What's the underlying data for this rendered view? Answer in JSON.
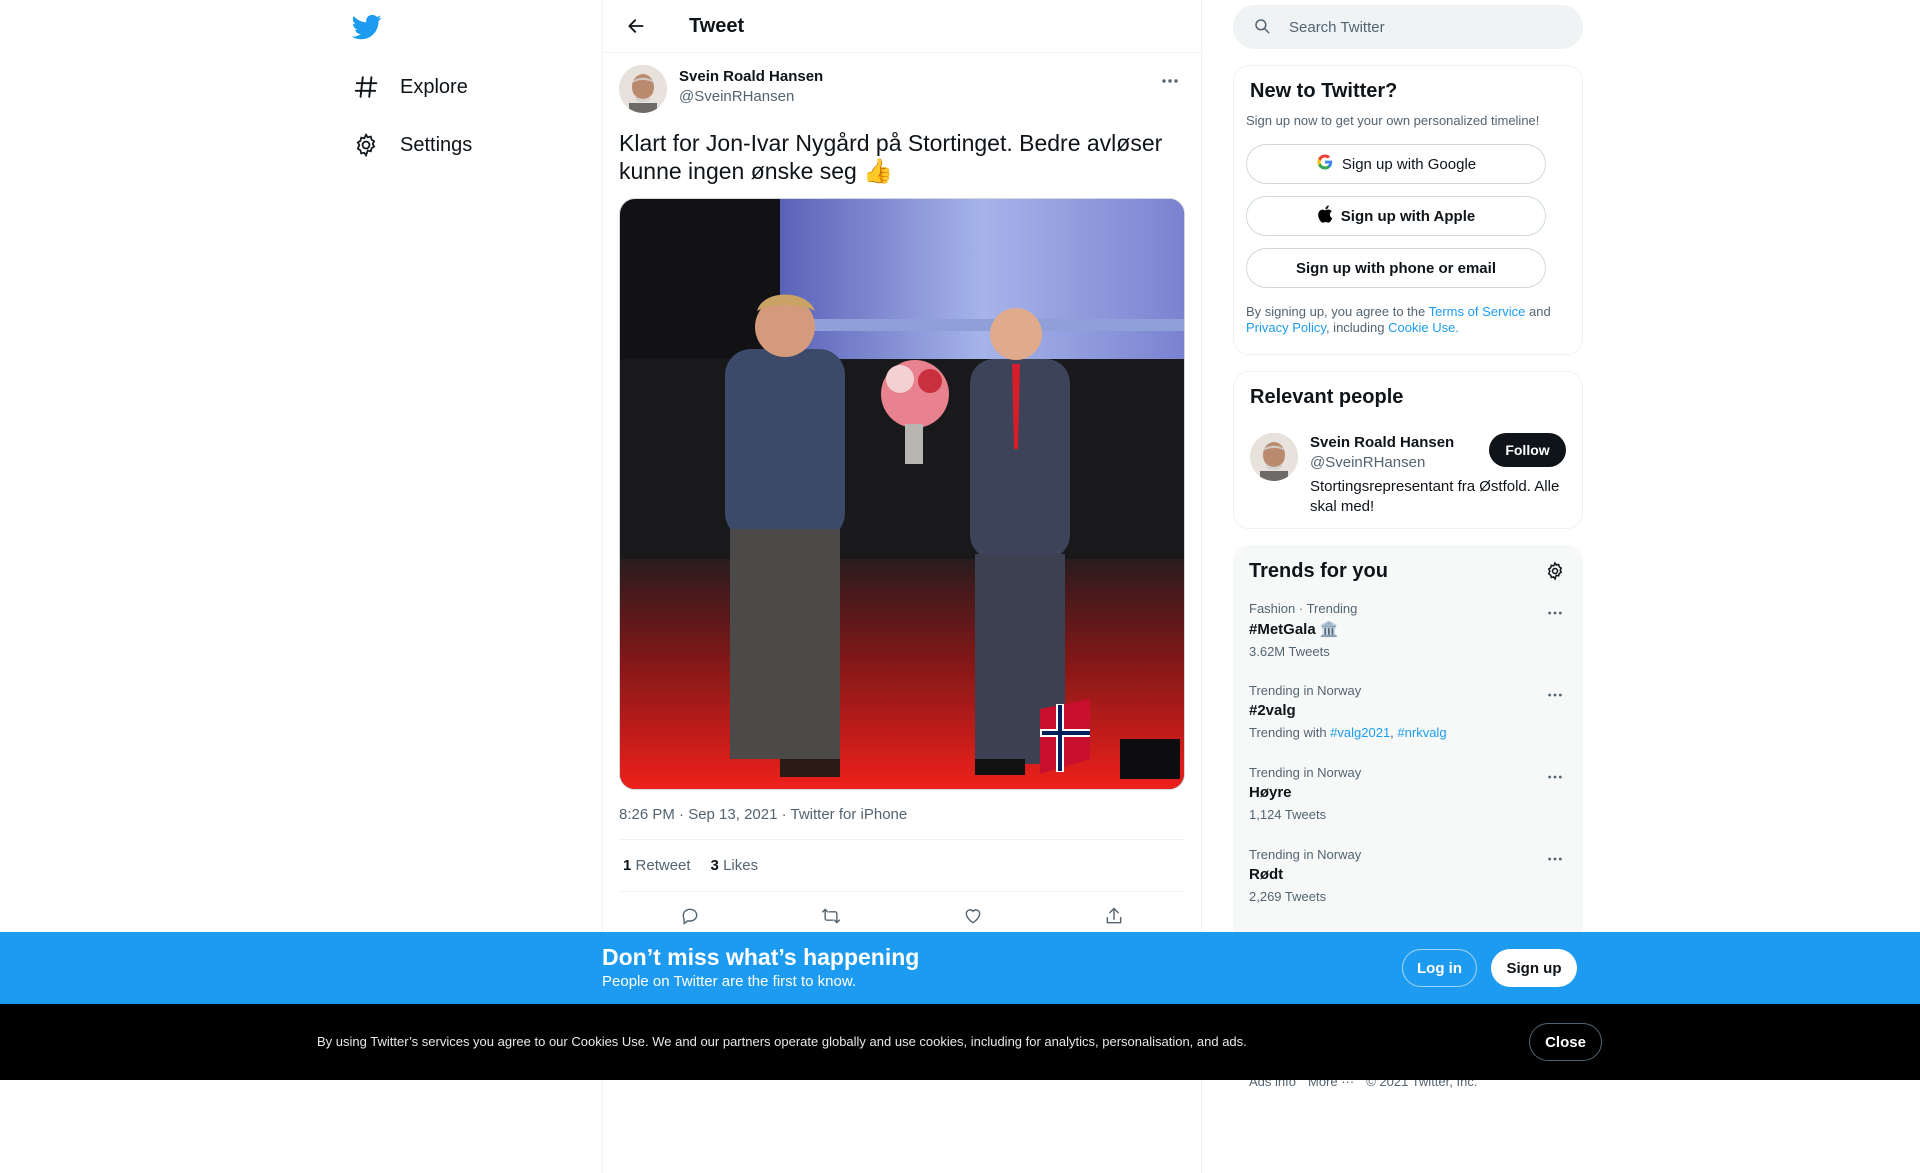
{
  "nav": {
    "items": [
      {
        "label": "Explore",
        "icon": "hashtag-icon"
      },
      {
        "label": "Settings",
        "icon": "gear-icon"
      }
    ]
  },
  "header": {
    "title": "Tweet"
  },
  "tweet": {
    "author_name": "Svein Roald Hansen",
    "author_handle": "@SveinRHansen",
    "text": "Klart for Jon-Ivar Nygård på Stortinget. Bedre avløser kunne ingen ønske seg",
    "emoji": "👍",
    "meta": "8:26 PM · Sep 13, 2021 · Twitter for iPhone",
    "retweets_count": "1",
    "retweets_label": "Retweet",
    "likes_count": "3",
    "likes_label": "Likes"
  },
  "search": {
    "placeholder": "Search Twitter"
  },
  "new_to_twitter": {
    "title": "New to Twitter?",
    "subtitle": "Sign up now to get your own personalized timeline!",
    "google_label": "Sign up with Google",
    "apple_label": "Sign up with Apple",
    "email_label": "Sign up with phone or email",
    "terms_prefix": "By signing up, you agree to the ",
    "terms_link": "Terms of Service",
    "terms_and": " and ",
    "privacy_link": "Privacy Policy",
    "including": ", including ",
    "cookie_link": "Cookie Use."
  },
  "relevant": {
    "title": "Relevant people",
    "name": "Svein Roald Hansen",
    "handle": "@SveinRHansen",
    "bio": "Stortingsrepresentant fra Østfold. Alle skal med!",
    "follow_label": "Follow"
  },
  "trends": {
    "title": "Trends for you",
    "items": [
      {
        "context": "Fashion · Trending",
        "name": "#MetGala 🏛️",
        "count": "3.62M Tweets"
      },
      {
        "context": "Trending in Norway",
        "name": "#2valg",
        "count_prefix": "Trending with ",
        "links": [
          "#valg2021",
          "#nrkvalg"
        ]
      },
      {
        "context": "Trending in Norway",
        "name": "Høyre",
        "count": "1,124 Tweets"
      },
      {
        "context": "Trending in Norway",
        "name": "Rødt",
        "count": "2,269 Tweets"
      }
    ]
  },
  "footer": {
    "ads": "Ads info",
    "more": "More ···",
    "copyright": "© 2021 Twitter, Inc."
  },
  "banner": {
    "title": "Don’t miss what’s happening",
    "subtitle": "People on Twitter are the first to know.",
    "login_label": "Log in",
    "signup_label": "Sign up"
  },
  "cookie": {
    "text": "By using Twitter’s services you agree to our Cookies Use. We and our partners operate globally and use cookies, including for analytics, personalisation, and ads.",
    "close_label": "Close"
  },
  "colors": {
    "brand": "#1d9bf0",
    "text": "#0f1419",
    "muted": "#536471"
  }
}
